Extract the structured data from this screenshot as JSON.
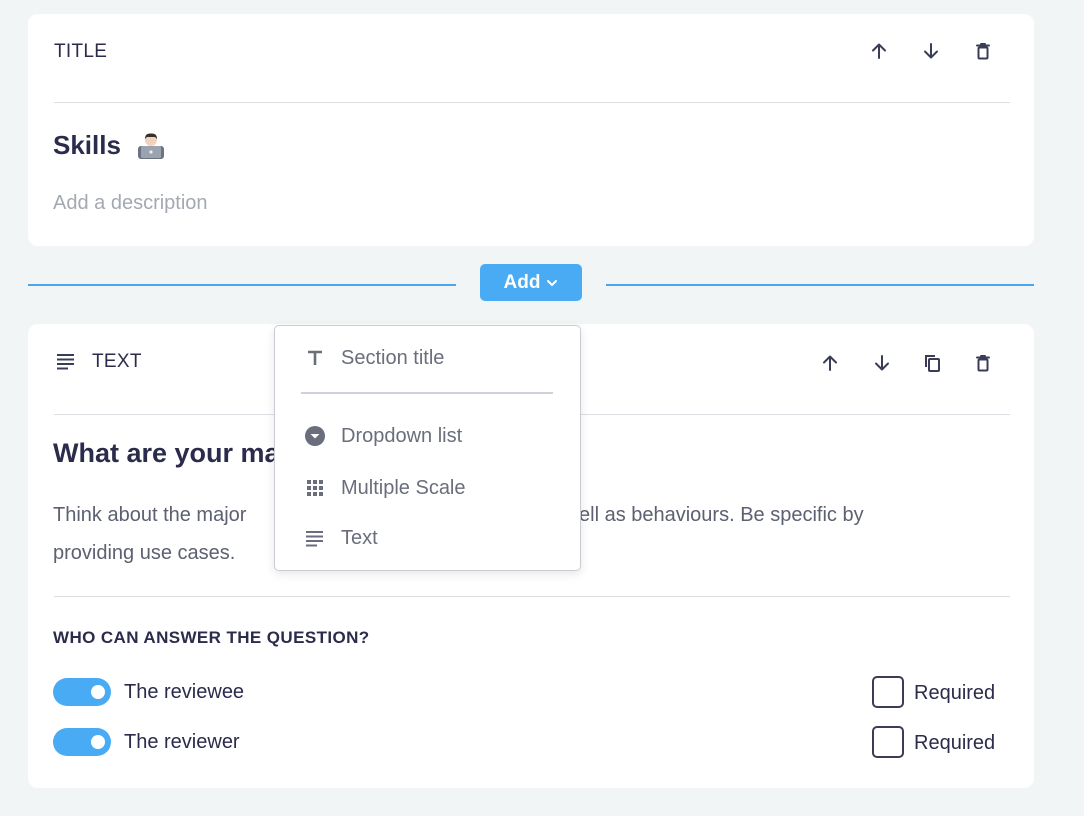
{
  "title_card": {
    "header_label": "TITLE",
    "section_name": "Skills",
    "description_placeholder": "Add a description",
    "icons": [
      "arrow-up-icon",
      "arrow-down-icon",
      "trash-icon"
    ]
  },
  "add_button": {
    "label": "Add"
  },
  "add_menu": {
    "items": [
      {
        "label": "Section title",
        "icon": "text-title-icon"
      },
      {
        "label": "Dropdown list",
        "icon": "dropdown-circle-icon"
      },
      {
        "label": "Multiple Scale",
        "icon": "grid-icon"
      },
      {
        "label": "Text",
        "icon": "lines-icon"
      }
    ]
  },
  "text_card": {
    "header_label": "TEXT",
    "question_title": "What are your ma",
    "question_body_left": "Think about the major",
    "question_body_right": "ell as behaviours. Be specific by",
    "question_body_line2": "providing use cases.",
    "who_heading": "WHO CAN ANSWER THE QUESTION?",
    "respondents": [
      {
        "label": "The reviewee",
        "enabled": true,
        "required_label": "Required",
        "required": false
      },
      {
        "label": "The reviewer",
        "enabled": true,
        "required_label": "Required",
        "required": false
      }
    ],
    "icons": [
      "arrow-up-icon",
      "arrow-down-icon",
      "copy-icon",
      "trash-icon"
    ]
  },
  "colors": {
    "accent": "#4aabf5",
    "background": "#f2f5f6",
    "text": "#2b2b4b"
  }
}
